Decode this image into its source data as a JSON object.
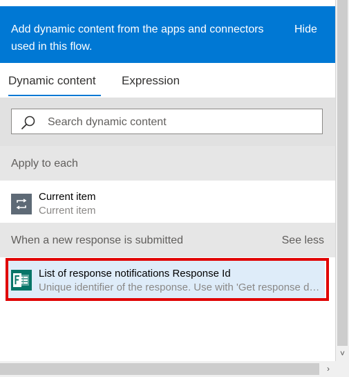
{
  "banner": {
    "message": "Add dynamic content from the apps and connectors used in this flow.",
    "hide_label": "Hide"
  },
  "tabs": [
    {
      "label": "Dynamic content",
      "active": true
    },
    {
      "label": "Expression",
      "active": false
    }
  ],
  "search": {
    "placeholder": "Search dynamic content",
    "value": ""
  },
  "sections": [
    {
      "title": "Apply to each",
      "items": [
        {
          "name": "Current item",
          "description": "Current item",
          "icon": "loop-icon",
          "icon_color": "#5e6a76"
        }
      ]
    },
    {
      "title": "When a new response is submitted",
      "toggle_label": "See less",
      "items": [
        {
          "name": "List of response notifications Response Id",
          "description": "Unique identifier of the response. Use with 'Get response det...",
          "icon": "forms-icon",
          "icon_color": "#077568",
          "selected": true
        }
      ]
    }
  ],
  "colors": {
    "banner": "#0078d4",
    "accent": "#0078d4",
    "highlight": "#e00000",
    "selected_row": "#deecf9"
  },
  "scrollbars": {
    "down_arrow": "˅",
    "right_arrow": "›"
  }
}
